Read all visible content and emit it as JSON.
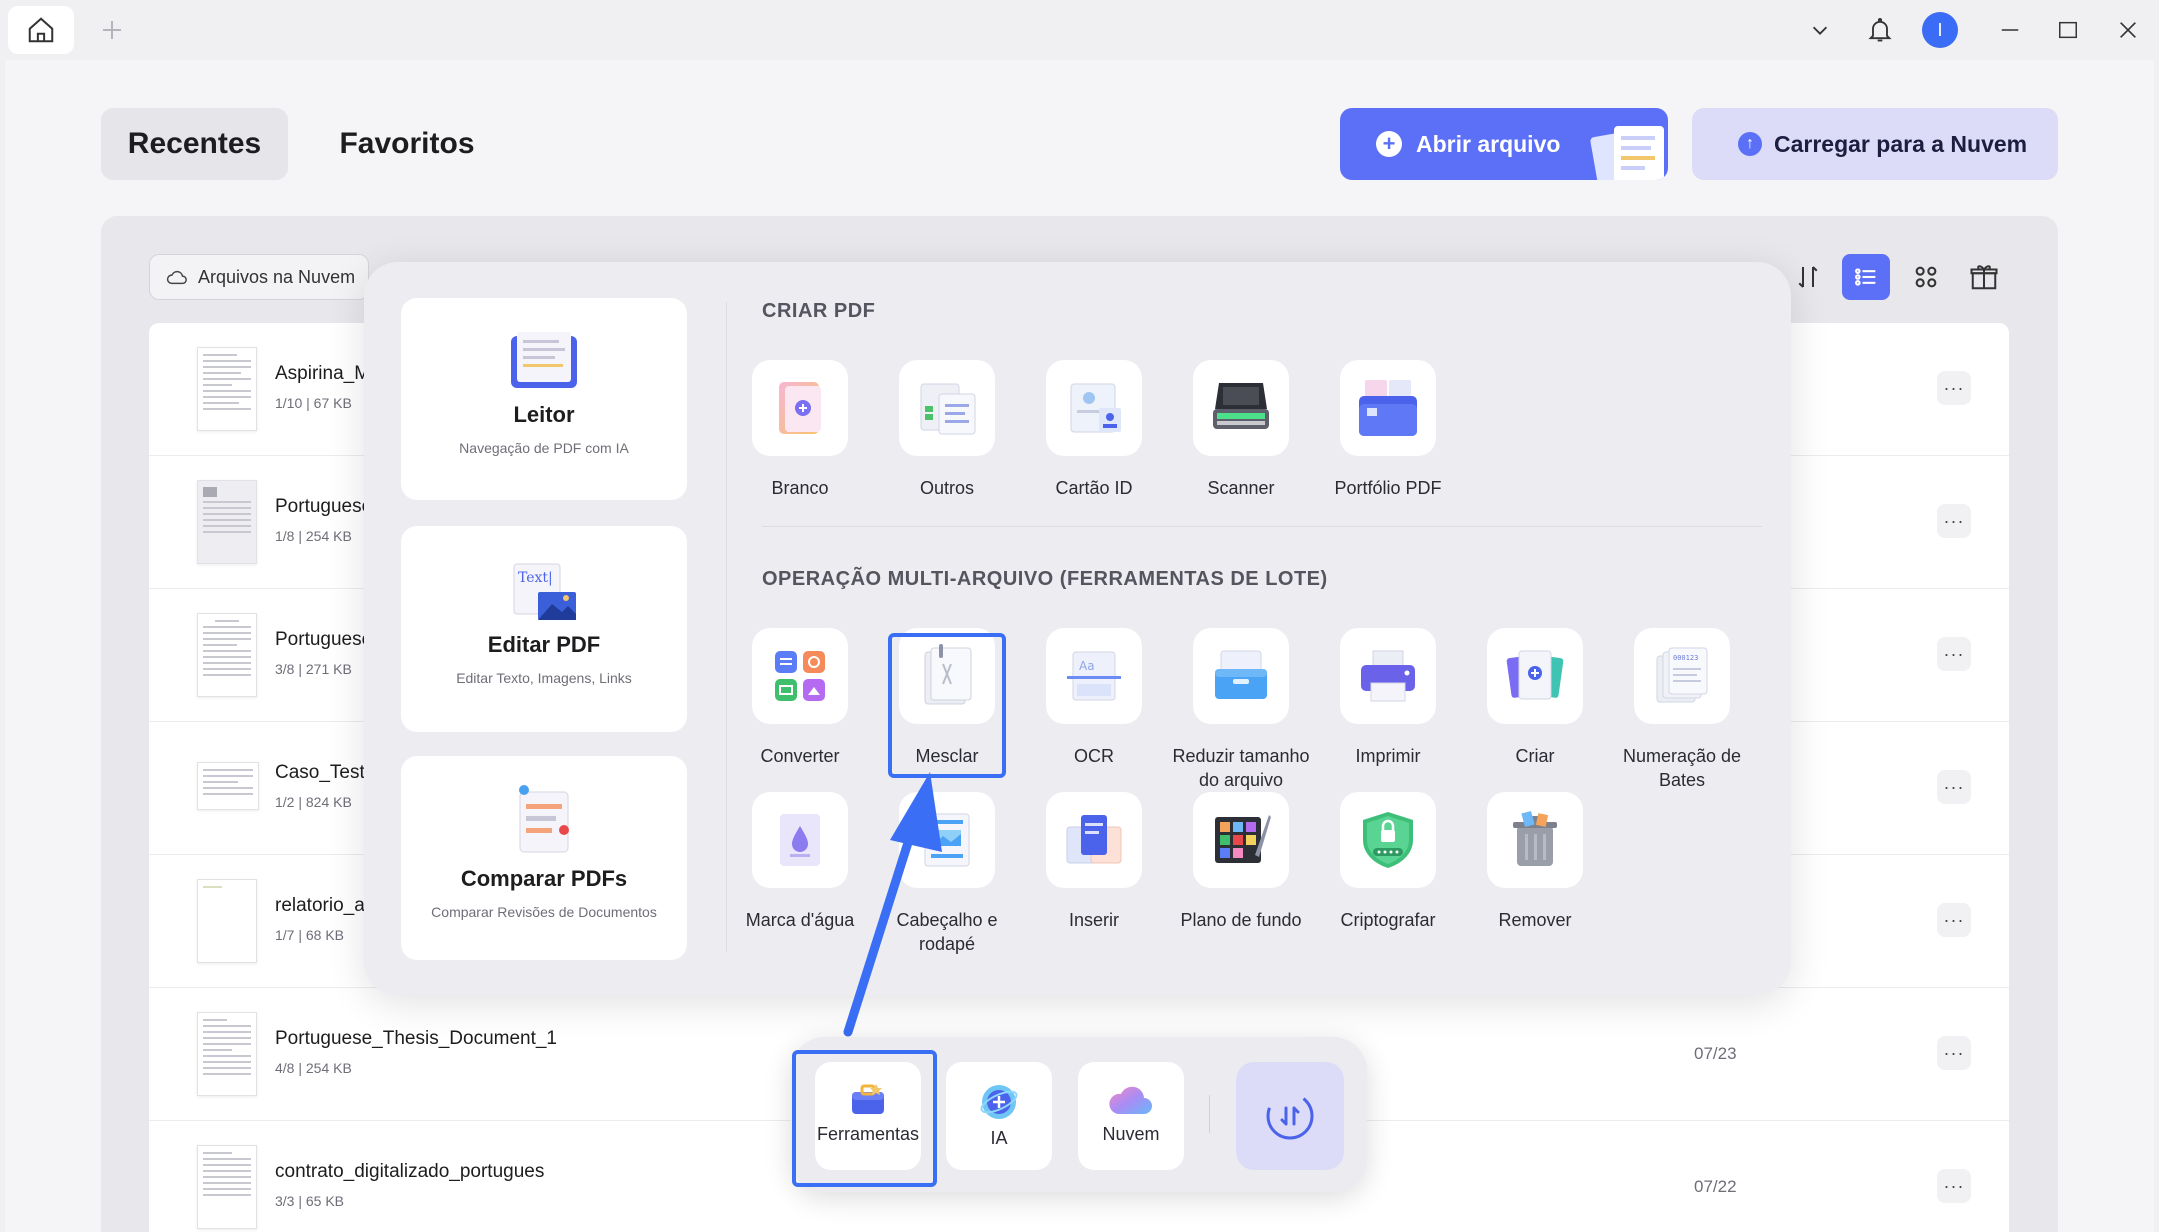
{
  "titlebar": {
    "avatar_initial": "I"
  },
  "tabs": {
    "recent": "Recentes",
    "favorites": "Favoritos"
  },
  "actions": {
    "open_file": "Abrir arquivo",
    "upload_cloud": "Carregar para a Nuvem"
  },
  "filter": {
    "cloud_files": "Arquivos na Nuvem"
  },
  "files": [
    {
      "name": "Aspirina_M",
      "meta": "1/10 | 67 KB",
      "date": ""
    },
    {
      "name": "Portuguese",
      "meta": "1/8 | 254 KB",
      "date": ""
    },
    {
      "name": "Portuguese",
      "meta": "3/8 | 271 KB",
      "date": ""
    },
    {
      "name": "Caso_Teste_",
      "meta": "1/2 | 824 KB",
      "date": ""
    },
    {
      "name": "relatorio_au",
      "meta": "1/7 | 68 KB",
      "date": ""
    },
    {
      "name": "Portuguese_Thesis_Document_1",
      "meta": "4/8 | 254 KB",
      "date": "07/23"
    },
    {
      "name": "contrato_digitalizado_portugues",
      "meta": "3/3 | 65 KB",
      "date": "07/22"
    }
  ],
  "more_label": "···",
  "popup": {
    "cards": [
      {
        "title": "Leitor",
        "subtitle": "Navegação de PDF com IA"
      },
      {
        "title": "Editar PDF",
        "subtitle": "Editar Texto, Imagens, Links",
        "icon_text": "Text|"
      },
      {
        "title": "Comparar PDFs",
        "subtitle": "Comparar Revisões de Documentos"
      }
    ],
    "create_title": "CRIAR PDF",
    "create_tools": [
      {
        "label": "Branco",
        "icon": "blank-pdf-icon"
      },
      {
        "label": "Outros",
        "icon": "others-icon"
      },
      {
        "label": "Cartão ID",
        "icon": "id-card-icon"
      },
      {
        "label": "Scanner",
        "icon": "scanner-icon"
      },
      {
        "label": "Portfólio PDF",
        "icon": "portfolio-icon"
      }
    ],
    "batch_title": "OPERAÇÃO MULTI-ARQUIVO (FERRAMENTAS DE LOTE)",
    "batch_tools": [
      {
        "label": "Converter",
        "icon": "convert-icon"
      },
      {
        "label": "Mesclar",
        "icon": "merge-icon"
      },
      {
        "label": "OCR",
        "icon": "ocr-icon"
      },
      {
        "label": "Reduzir tamanho do arquivo",
        "icon": "compress-icon"
      },
      {
        "label": "Imprimir",
        "icon": "print-icon"
      },
      {
        "label": "Criar",
        "icon": "create-icon"
      },
      {
        "label": "Numeração de Bates",
        "icon": "bates-icon",
        "icon_text": "000123"
      },
      {
        "label": "Marca d'água",
        "icon": "watermark-icon"
      },
      {
        "label": "Cabeçalho e rodapé",
        "icon": "header-footer-icon"
      },
      {
        "label": "Inserir",
        "icon": "insert-icon"
      },
      {
        "label": "Plano de fundo",
        "icon": "background-icon"
      },
      {
        "label": "Criptografar",
        "icon": "encrypt-icon"
      },
      {
        "label": "Remover",
        "icon": "remove-icon"
      }
    ]
  },
  "dock": {
    "tools": "Ferramentas",
    "ai": "IA",
    "cloud": "Nuvem"
  },
  "colors": {
    "accent": "#5b6ff7",
    "highlight": "#3a6ef5"
  }
}
